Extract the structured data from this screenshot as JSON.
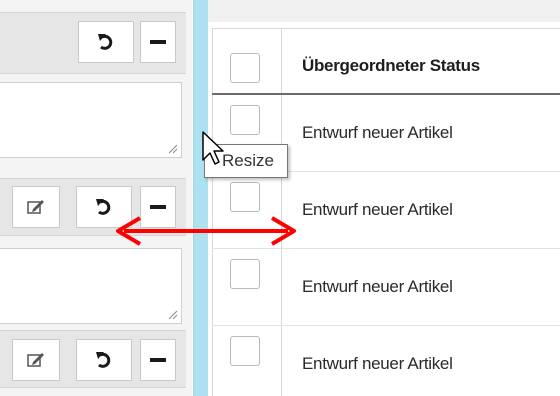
{
  "tooltip": {
    "text": "Resize"
  },
  "table": {
    "header": "Übergeordneter Status",
    "rows": [
      {
        "status": "Entwurf neuer Artikel"
      },
      {
        "status": "Entwurf neuer Artikel"
      },
      {
        "status": "Entwurf neuer Artikel"
      },
      {
        "status": "Entwurf neuer Artikel"
      }
    ]
  },
  "icons": {
    "undo": "undo-icon",
    "collapse": "minus-icon",
    "edit": "edit-icon",
    "resize_grip": "resize-grip-icon",
    "cursor": "arrow-cursor-icon",
    "arrow": "double-arrow-icon"
  },
  "colors": {
    "splitter": "#aee1f0",
    "arrow": "#ff0000",
    "header_border": "#6c6c6c"
  }
}
